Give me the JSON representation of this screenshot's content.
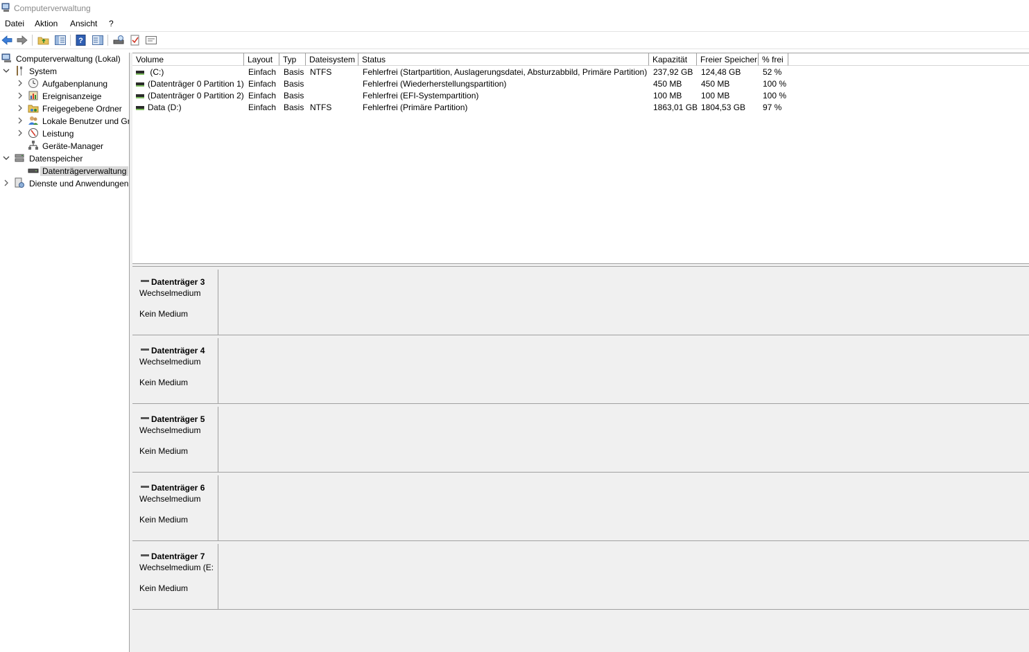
{
  "window": {
    "title": "Computerverwaltung"
  },
  "menu": [
    "Datei",
    "Aktion",
    "Ansicht",
    "?"
  ],
  "toolbar": {
    "icons": [
      "back-arrow-icon",
      "forward-arrow-icon",
      "up-folder-icon",
      "show-hide-tree-icon",
      "help-icon",
      "show-hide-action-pane-icon",
      "connect-icon",
      "check-icon",
      "properties-icon"
    ]
  },
  "tree": {
    "root": "Computerverwaltung (Lokal)",
    "system": "System",
    "aufgaben": "Aufgabenplanung",
    "ereignis": "Ereignisanzeige",
    "freigegeben": "Freigegebene Ordner",
    "lokale": "Lokale Benutzer und Gr",
    "leistung": "Leistung",
    "geraete": "Geräte-Manager",
    "datenspeicher": "Datenspeicher",
    "datentraeger": "Datenträgerverwaltung",
    "dienste": "Dienste und Anwendungen"
  },
  "volumes": {
    "headers": {
      "volume": "Volume",
      "layout": "Layout",
      "typ": "Typ",
      "dateisystem": "Dateisystem",
      "status": "Status",
      "kapazitaet": "Kapazität",
      "freier": "Freier Speicher",
      "frei": "% frei"
    },
    "rows": [
      {
        "volume": " (C:)",
        "layout": "Einfach",
        "typ": "Basis",
        "fs": "NTFS",
        "status": "Fehlerfrei (Startpartition, Auslagerungsdatei, Absturzabbild, Primäre Partition)",
        "kap": "237,92 GB",
        "free": "124,48 GB",
        "pct": "52 %"
      },
      {
        "volume": "(Datenträger 0 Partition 1)",
        "layout": "Einfach",
        "typ": "Basis",
        "fs": "",
        "status": "Fehlerfrei (Wiederherstellungspartition)",
        "kap": "450 MB",
        "free": "450 MB",
        "pct": "100 %"
      },
      {
        "volume": "(Datenträger 0 Partition 2)",
        "layout": "Einfach",
        "typ": "Basis",
        "fs": "",
        "status": "Fehlerfrei (EFI-Systempartition)",
        "kap": "100 MB",
        "free": "100 MB",
        "pct": "100 %"
      },
      {
        "volume": "Data (D:)",
        "layout": "Einfach",
        "typ": "Basis",
        "fs": "NTFS",
        "status": "Fehlerfrei (Primäre Partition)",
        "kap": "1863,01 GB",
        "free": "1804,53 GB",
        "pct": "97 %"
      }
    ]
  },
  "disks": [
    {
      "name": "Datenträger 3",
      "type": "Wechselmedium",
      "media": "Kein Medium"
    },
    {
      "name": "Datenträger 4",
      "type": "Wechselmedium",
      "media": "Kein Medium"
    },
    {
      "name": "Datenträger 5",
      "type": "Wechselmedium",
      "media": "Kein Medium"
    },
    {
      "name": "Datenträger 6",
      "type": "Wechselmedium",
      "media": "Kein Medium"
    },
    {
      "name": "Datenträger 7",
      "type": "Wechselmedium (E:",
      "media": "Kein Medium"
    }
  ]
}
